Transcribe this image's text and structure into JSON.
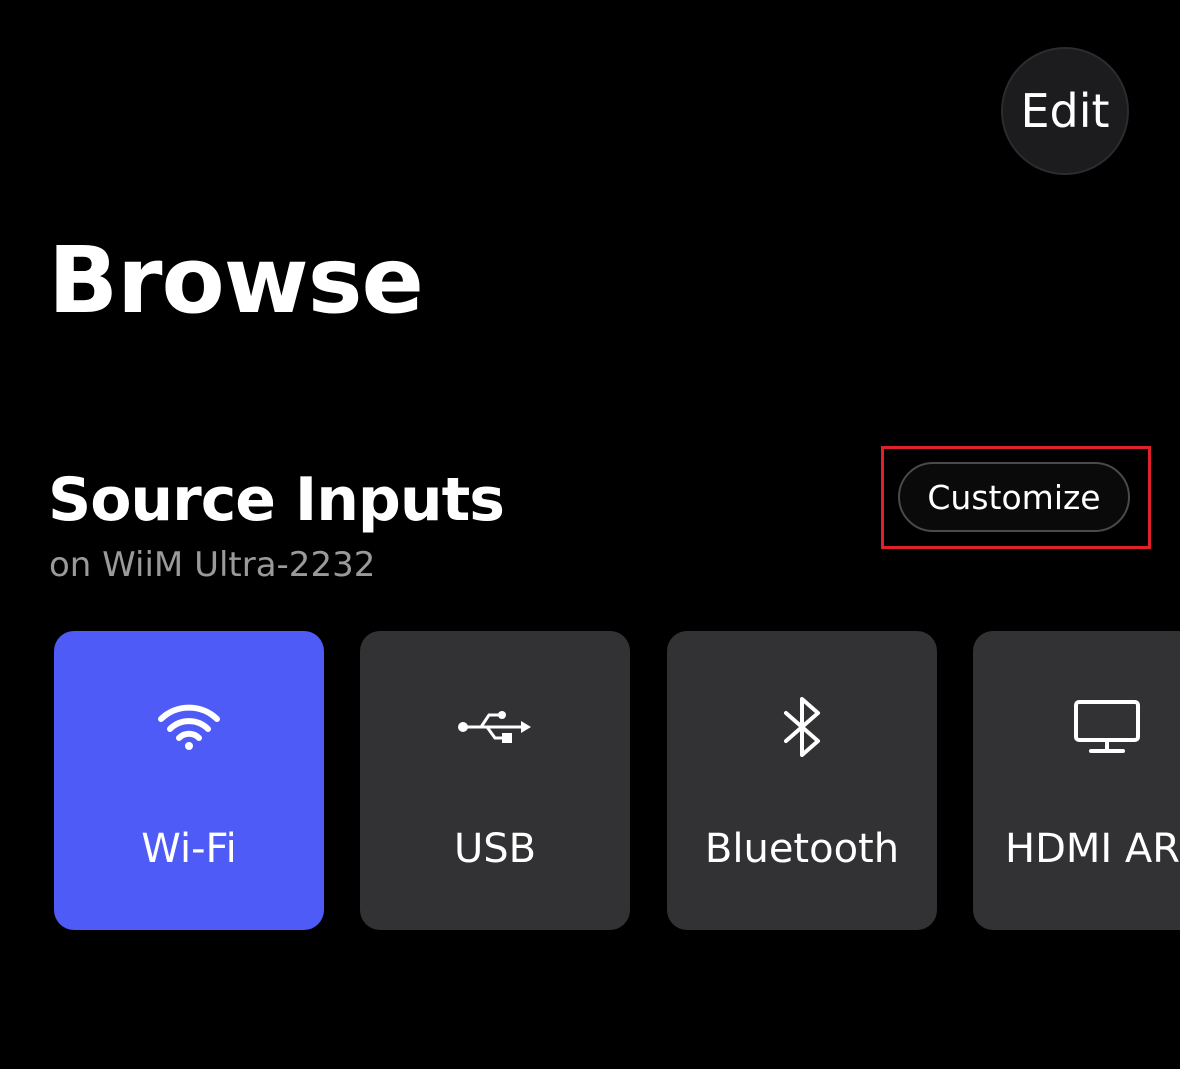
{
  "header": {
    "edit_label": "Edit"
  },
  "page": {
    "title": "Browse"
  },
  "source_inputs": {
    "title": "Source Inputs",
    "subtitle": "on WiiM Ultra-2232",
    "customize_label": "Customize",
    "items": [
      {
        "label": "Wi-Fi",
        "icon": "wifi-icon",
        "selected": true
      },
      {
        "label": "USB",
        "icon": "usb-icon",
        "selected": false
      },
      {
        "label": "Bluetooth",
        "icon": "bluetooth-icon",
        "selected": false
      },
      {
        "label": "HDMI ARC",
        "icon": "monitor-icon",
        "selected": false
      }
    ]
  },
  "colors": {
    "background": "#000000",
    "tile": "#323234",
    "tile_selected": "#4f5bf7",
    "highlight": "#e0212b",
    "subtitle": "#9a9a9a"
  }
}
